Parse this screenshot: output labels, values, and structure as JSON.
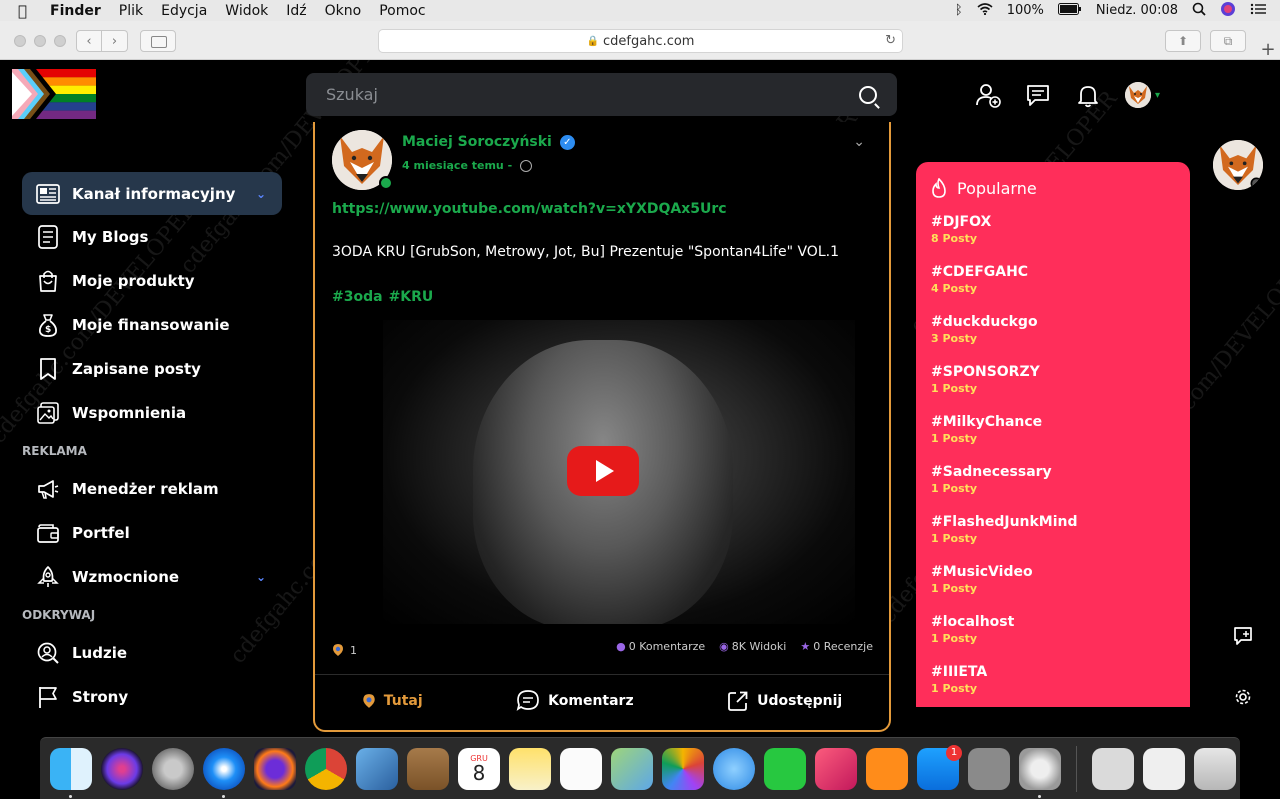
{
  "menubar": {
    "apple": "",
    "app_name": "Finder",
    "items": [
      "Plik",
      "Edycja",
      "Widok",
      "Idź",
      "Okno",
      "Pomoc"
    ],
    "battery": "100%",
    "clock": "Niedz. 00:08"
  },
  "browser": {
    "url": "cdefgahc.com"
  },
  "search": {
    "placeholder": "Szukaj"
  },
  "nav": {
    "items": [
      {
        "label": "Kanał informacyjny",
        "icon": "newspaper-icon"
      },
      {
        "label": "My Blogs",
        "icon": "document-icon"
      },
      {
        "label": "Moje produkty",
        "icon": "shopping-bag-icon"
      },
      {
        "label": "Moje finansowanie",
        "icon": "money-bag-icon"
      },
      {
        "label": "Zapisane posty",
        "icon": "bookmark-icon"
      },
      {
        "label": "Wspomnienia",
        "icon": "photos-icon"
      }
    ],
    "section_ads": "REKLAMA",
    "ads_items": [
      {
        "label": "Menedżer reklam",
        "icon": "megaphone-icon"
      },
      {
        "label": "Portfel",
        "icon": "wallet-icon"
      },
      {
        "label": "Wzmocnione",
        "icon": "rocket-icon"
      }
    ],
    "section_discover": "ODKRYWAJ",
    "discover_items": [
      {
        "label": "Ludzie",
        "icon": "people-search-icon"
      },
      {
        "label": "Strony",
        "icon": "flag-icon"
      }
    ]
  },
  "post": {
    "author": "Maciej Soroczyński",
    "time": "4 miesiące temu -",
    "link": "https://www.youtube.com/watch?v=xYXDQAx5Urc",
    "text": "3ODA KRU [GrubSon, Metrowy, Jot, Bu] Prezentuje \"Spontan4Life\" VOL.1",
    "tags": [
      "#3oda",
      "#KRU"
    ],
    "reactions_count": "1",
    "comments": "0 Komentarze",
    "views": "8K Widoki",
    "reviews": "0 Recenzje",
    "actions": {
      "here": "Tutaj",
      "comment": "Komentarz",
      "share": "Udostępnij"
    }
  },
  "popular": {
    "title": "Popularne",
    "entries": [
      {
        "tag": "#DJFOX",
        "count": "8 Posty"
      },
      {
        "tag": "#CDEFGAHC",
        "count": "4 Posty"
      },
      {
        "tag": "#duckduckgo",
        "count": "3 Posty"
      },
      {
        "tag": "#SPONSORZY",
        "count": "1 Posty"
      },
      {
        "tag": "#MilkyChance",
        "count": "1 Posty"
      },
      {
        "tag": "#Sadnecessary",
        "count": "1 Posty"
      },
      {
        "tag": "#FlashedJunkMind",
        "count": "1 Posty"
      },
      {
        "tag": "#MusicVideo",
        "count": "1 Posty"
      },
      {
        "tag": "#localhost",
        "count": "1 Posty"
      },
      {
        "tag": "#IIIETA",
        "count": "1 Posty"
      }
    ]
  },
  "watermark": "cdefgahc.com/DEVELOPER",
  "dock": {
    "calendar_month": "GRU",
    "calendar_day": "8",
    "appstore_badge": "1"
  },
  "colors": {
    "accent_green": "#1ba94c",
    "popular_bg": "#ff2e5a",
    "card_border": "#e39a3b",
    "nav_active_bg": "#26374b"
  }
}
